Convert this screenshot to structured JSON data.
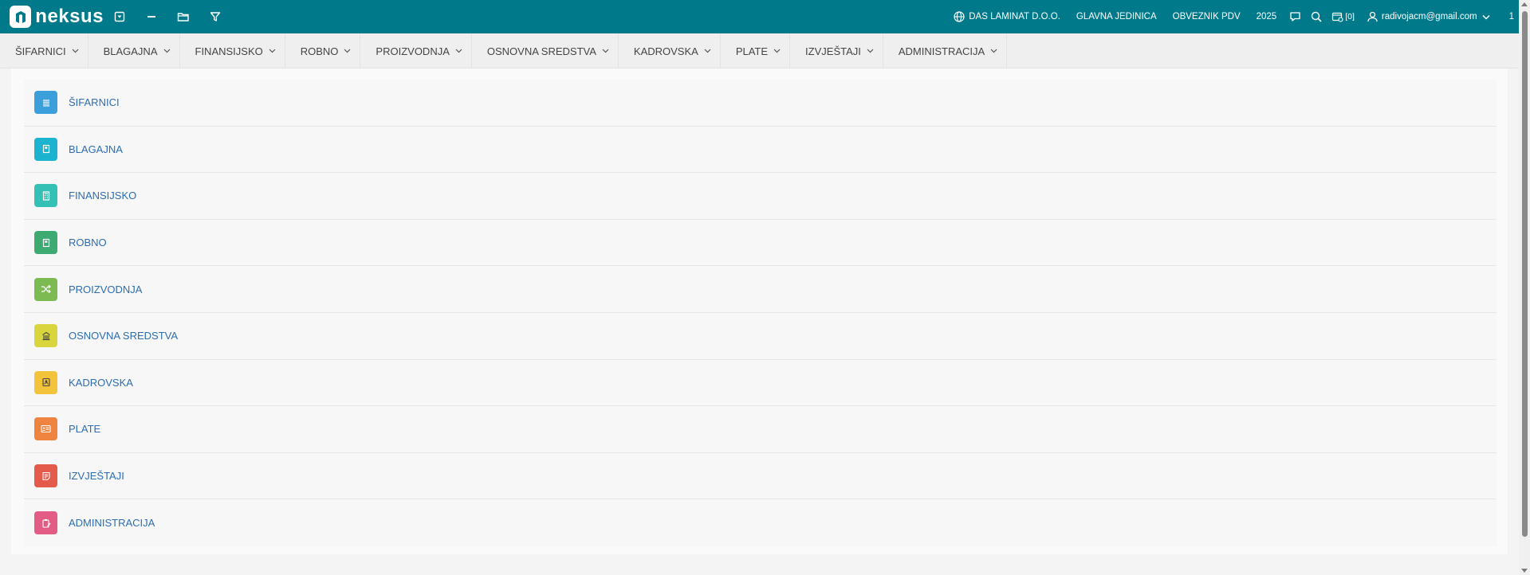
{
  "app": {
    "logo_text": "neksus",
    "brand_color": "#007a8a"
  },
  "toolbar_icons": [
    "dropdown-box-icon",
    "minimize-icon",
    "folder-icon",
    "filter-icon"
  ],
  "header": {
    "company": "DAS LAMINAT D.O.O.",
    "unit": "GLAVNA JEDINICA",
    "tax": "OBVEZNIK PDV",
    "year": "2025",
    "notifications_count": "[0]",
    "user_email": "radivojacm@gmail.com",
    "page": "1"
  },
  "menu": [
    {
      "label": "ŠIFARNICI"
    },
    {
      "label": "BLAGAJNA"
    },
    {
      "label": "FINANSIJSKO"
    },
    {
      "label": "ROBNO"
    },
    {
      "label": "PROIZVODNJA"
    },
    {
      "label": "OSNOVNA SREDSTVA"
    },
    {
      "label": "KADROVSKA"
    },
    {
      "label": "PLATE"
    },
    {
      "label": "IZVJEŠTAJI"
    },
    {
      "label": "ADMINISTRACIJA"
    }
  ],
  "modules": [
    {
      "label": "ŠIFARNICI",
      "color": "#3b9fdc",
      "icon": "list-icon"
    },
    {
      "label": "BLAGAJNA",
      "color": "#1bb3cf",
      "icon": "book-icon"
    },
    {
      "label": "FINANSIJSKO",
      "color": "#35c0b6",
      "icon": "calculator-icon"
    },
    {
      "label": "ROBNO",
      "color": "#3daa72",
      "icon": "book-icon"
    },
    {
      "label": "PROIZVODNJA",
      "color": "#7cba52",
      "icon": "shuffle-icon"
    },
    {
      "label": "OSNOVNA SREDSTVA",
      "color": "#d9d63d",
      "icon": "building-icon"
    },
    {
      "label": "KADROVSKA",
      "color": "#f3c33b",
      "icon": "contact-icon"
    },
    {
      "label": "PLATE",
      "color": "#ee8440",
      "icon": "id-card-icon"
    },
    {
      "label": "IZVJEŠTAJI",
      "color": "#e45a4b",
      "icon": "report-icon"
    },
    {
      "label": "ADMINISTRACIJA",
      "color": "#e35c86",
      "icon": "clipboard-edit-icon"
    }
  ]
}
